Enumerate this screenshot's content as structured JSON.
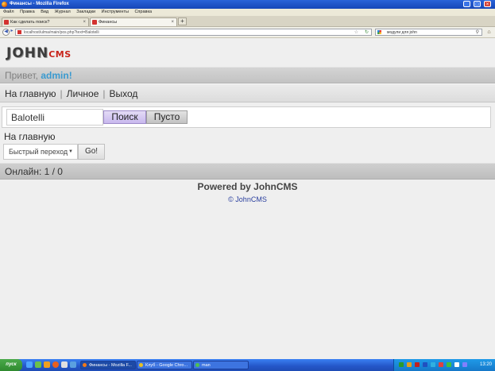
{
  "browser": {
    "window_title": "Финансы - Mozilla Firefox",
    "menu": [
      "Файл",
      "Правка",
      "Вид",
      "Журнал",
      "Закладки",
      "Инструменты",
      "Справка"
    ],
    "tabs": [
      {
        "label": "Как сделать поиск?"
      },
      {
        "label": "Финансы"
      }
    ],
    "new_tab": "+",
    "url": "localhost/ulma/main/pos.php?text=Balotelli",
    "search_engine_text": "модули для john"
  },
  "page": {
    "logo_john": "JOHN",
    "logo_cms": "CMS",
    "greeting": "Привет,",
    "username": "admin",
    "greeting_cursor": "!",
    "nav_links": [
      "На главную",
      "Личное",
      "Выход"
    ],
    "search_value": "Balotelli",
    "search_button": "Поиск",
    "clear_button": "Пусто",
    "home_link": "На главную",
    "jump_select": "Быстрый переход",
    "go_button": "Go!",
    "online": "Онлайн: 1 / 0",
    "powered": "Powered by JohnCMS",
    "copyright": "© JohnCMS"
  },
  "taskbar": {
    "start": "пуск",
    "windows": [
      {
        "label": "Финансы - Mozilla F..."
      },
      {
        "label": "Клуб - Google Chro..."
      },
      {
        "label": "man"
      }
    ],
    "clock": "13:20"
  },
  "colors": {
    "accent_link": "#3a9ad0",
    "logo_red": "#c8241b",
    "taskbar_blue": "#2456c8"
  }
}
